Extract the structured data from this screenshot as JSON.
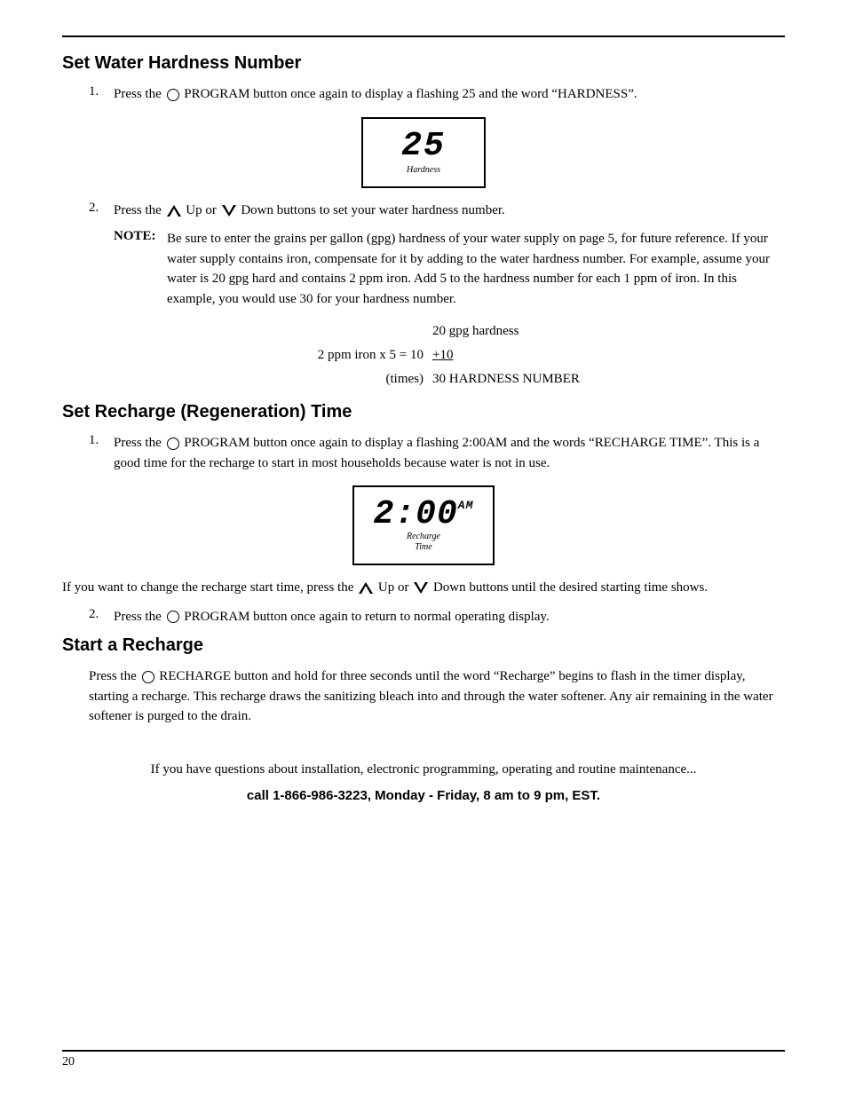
{
  "page": {
    "page_number": "20",
    "top_border": true
  },
  "section1": {
    "title": "Set Water Hardness Number",
    "step1": {
      "number": "1.",
      "text_before": "Press the",
      "circle": true,
      "text_after": "PROGRAM button once again to display a flashing 25 and the word “HARDNESS”."
    },
    "display1": {
      "number": "25",
      "label": "Hardness"
    },
    "step2": {
      "number": "2.",
      "text_before": "Press the",
      "up_arrow": true,
      "up_label": "Up",
      "or_text": "or",
      "down_arrow": true,
      "down_label": "Down",
      "text_after": "buttons to set your water hardness number."
    },
    "note": {
      "label": "NOTE:",
      "text": "Be sure to enter the grains per gallon (gpg) hardness of your water supply on page 5, for future reference.  If your water supply contains iron, compensate for it by adding to the water hardness number. For example, assume your water is 20 gpg hard and contains 2 ppm iron. Add 5 to the hardness number for each 1 ppm of iron. In this example, you would use 30 for your hardness number."
    },
    "calc": {
      "row1_col1": "",
      "row1_col2": "20 gpg hardness",
      "row2_col1": "2 ppm iron x 5 = 10",
      "row2_col2_underline": "+10",
      "row3_col1": "(times)",
      "row3_col2": "30 HARDNESS NUMBER"
    }
  },
  "section2": {
    "title": "Set Recharge (Regeneration) Time",
    "step1": {
      "number": "1.",
      "text_before": "Press the",
      "circle": true,
      "text_after": "PROGRAM button once again to display a flashing 2:00AM and the words “RECHARGE TIME”. This is a good time for the recharge to start in most households because water is not in use."
    },
    "display2": {
      "number": "2:00",
      "am_label": "AM",
      "label_line1": "Recharge",
      "label_line2": "Time"
    },
    "change_text": "If you want to change the recharge start time, press the",
    "change_up": true,
    "change_up_label": "Up",
    "change_or": "or",
    "change_down": true,
    "change_down_label": "Down",
    "change_after": "Down buttons until the desired starting time shows.",
    "step2": {
      "number": "2.",
      "text_before": "Press the",
      "circle": true,
      "text_after": "PROGRAM button once again to return to normal operating display."
    }
  },
  "section3": {
    "title": "Start a Recharge",
    "paragraph": "Press the  RECHARGE button and hold for three seconds until the word “Recharge” begins to flash in the timer display, starting a recharge. This recharge draws the sanitizing bleach into and through the water softener. Any air remaining in the water softener is purged to the drain."
  },
  "footer": {
    "question_text": "If you have questions about installation, electronic programming, operating and routine maintenance...",
    "call_text": "call 1-866-986-3223, Monday - Friday, 8 am to 9 pm, EST."
  }
}
